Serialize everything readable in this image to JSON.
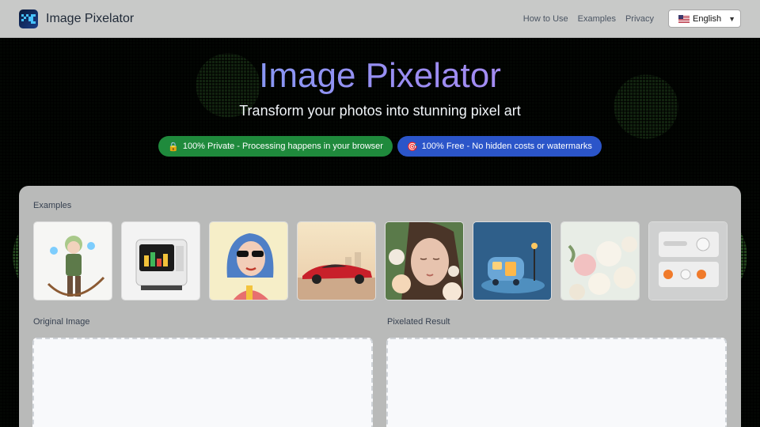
{
  "header": {
    "brand": "Image Pixelator",
    "nav": [
      "How to Use",
      "Examples",
      "Privacy"
    ],
    "language": "English"
  },
  "hero": {
    "title": "Image Pixelator",
    "subtitle": "Transform your photos into stunning pixel art",
    "badges": [
      {
        "icon": "lock-icon",
        "text": "100% Private - Processing happens in your browser",
        "color": "#1f8a3c"
      },
      {
        "icon": "target-icon",
        "text": "100% Free - No hidden costs or watermarks",
        "color": "#2b55c9"
      }
    ]
  },
  "panel": {
    "examples_label": "Examples",
    "examples": [
      "archer-character",
      "retro-monitor-chart",
      "woman-sunglasses",
      "red-sports-car",
      "woman-with-roses",
      "camper-van-lamp",
      "white-roses-bouquet",
      "control-panel-knobs"
    ],
    "original_label": "Original Image",
    "result_label": "Pixelated Result"
  },
  "colors": {
    "accent_gradient_start": "#6aa8f4",
    "accent_gradient_end": "#c18ef5",
    "panel_bg": "#b9bab9",
    "header_bg": "#c8c9c8"
  }
}
